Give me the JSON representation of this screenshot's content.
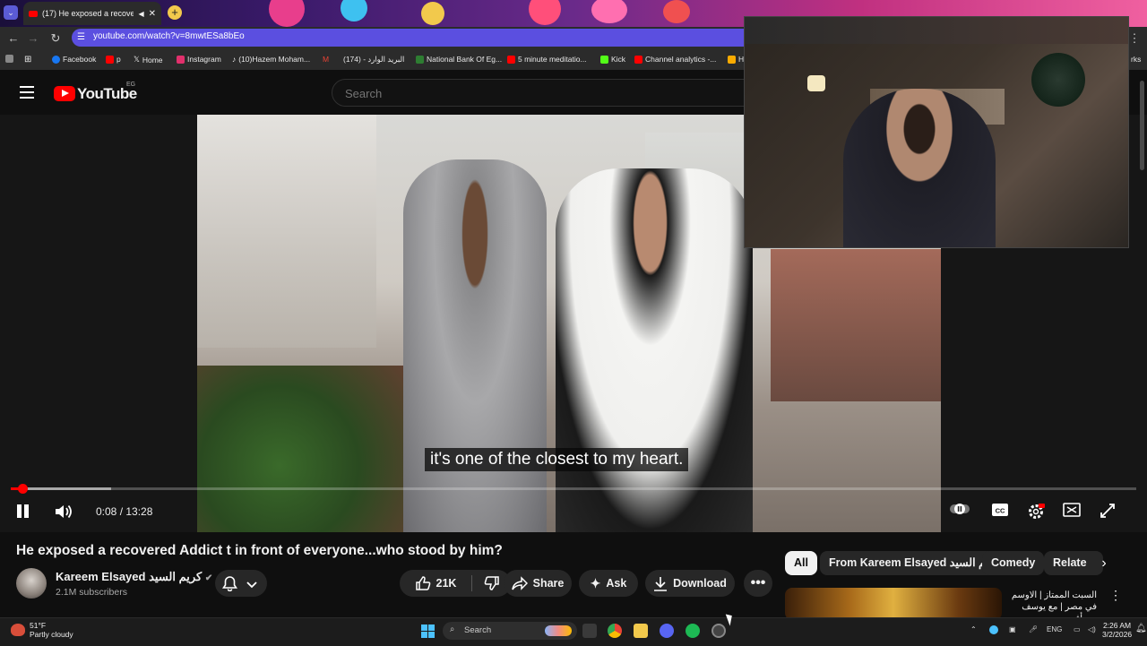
{
  "browser": {
    "tab_title": "(17) He exposed a recovere...",
    "url": "youtube.com/watch?v=8mwtESa8bEo",
    "bookmarks": [
      {
        "label": "Facebook",
        "color": "#1877f2"
      },
      {
        "label": "p",
        "color": "#ff0000"
      },
      {
        "label": "Home",
        "color": "#ffffff"
      },
      {
        "label": "Instagram",
        "color": "#e1306c"
      },
      {
        "label": "(10)Hazem Moham...",
        "color": "#ffffff"
      },
      {
        "label": "",
        "color": "#ea4335"
      },
      {
        "label": "(174) - البريد الوارد",
        "color": "#ea4335"
      },
      {
        "label": "National Bank Of Eg...",
        "color": "#2e7d32"
      },
      {
        "label": "5 minute meditatio...",
        "color": "#ff0000"
      },
      {
        "label": "Kick",
        "color": "#53fc18"
      },
      {
        "label": "Channel analytics -...",
        "color": "#ff0000"
      },
      {
        "label": "H",
        "color": "#f9ab00"
      }
    ],
    "bookmarks_overflow": "rks"
  },
  "youtube": {
    "logo_text": "YouTube",
    "country": "EG",
    "search_placeholder": "Search"
  },
  "player": {
    "subtitle": "it's one of the closest to my heart.",
    "current_time": "0:08",
    "duration": "13:28",
    "time_text": "0:08 / 13:28",
    "played_fraction": 0.01,
    "buffered_fraction": 0.089,
    "playing": true
  },
  "video": {
    "title": "He exposed a recovered Addict t in front of everyone...who stood by him?",
    "channel_name": "Kareem Elsayed كريم السيد",
    "verified": true,
    "subscribers": "2.1M subscribers",
    "likes": "21K",
    "share_label": "Share",
    "ask_label": "Ask",
    "download_label": "Download"
  },
  "sidebar": {
    "chips": [
      "All",
      "From Kareem Elsayed كريم السيد",
      "Comedy",
      "Relate"
    ],
    "active_chip": "All",
    "related_title": "السبت الممتاز | الاوسم في مصر | مع يوسف رأفت ..."
  },
  "taskbar": {
    "weather_temp": "51°F",
    "weather_desc": "Partly cloudy",
    "search_label": "Search",
    "language": "ENG",
    "time": "2:26 AM",
    "date": "3/2/2026"
  }
}
